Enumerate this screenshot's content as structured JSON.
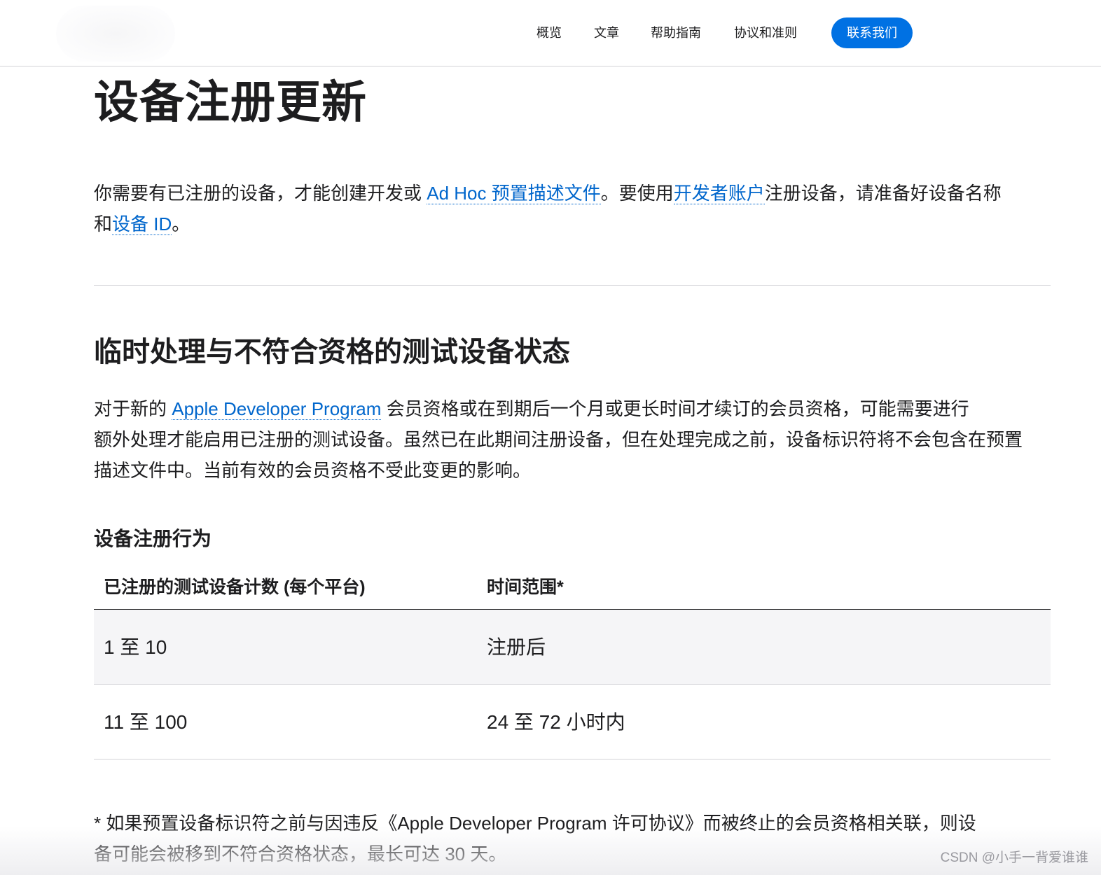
{
  "nav": {
    "items": [
      {
        "label": "概览"
      },
      {
        "label": "文章"
      },
      {
        "label": "帮助指南"
      },
      {
        "label": "协议和准则"
      }
    ],
    "cta_label": "联系我们"
  },
  "page": {
    "title": "设备注册更新",
    "intro": {
      "part1": "你需要有已注册的设备，才能创建开发或 ",
      "link1": "Ad Hoc 预置描述文件",
      "part2": "。要使用",
      "link2": "开发者账户",
      "part3": "注册设备，请准备好设备名称",
      "part4": "和",
      "link3": "设备 ID",
      "part5": "。"
    },
    "section": {
      "heading": "临时处理与不符合资格的测试设备状态",
      "para": {
        "part1": "对于新的 ",
        "link": "Apple Developer Program",
        "part2": " 会员资格或在到期后一个月或更长时间才续订的会员资格，可能需要进行",
        "line2": "额外处理才能启用已注册的测试设备。虽然已在此期间注册设备，但在处理完成之前，设备标识符将不会包含在预置",
        "line3": "描述文件中。当前有效的会员资格不受此变更的影响。"
      },
      "subheading": "设备注册行为",
      "table": {
        "headers": [
          "已注册的测试设备计数 (每个平台)",
          "时间范围*"
        ],
        "rows": [
          [
            "1 至 10",
            "注册后"
          ],
          [
            "11 至 100",
            "24 至 72 小时内"
          ]
        ]
      },
      "footnote": {
        "line1": "* 如果预置设备标识符之前与因违反《Apple Developer Program 许可协议》而被终止的会员资格相关联，则设",
        "line2": "备可能会被移到不符合资格状态，最长可达 30 天。"
      }
    }
  },
  "watermark": "CSDN @小手一背爱谁谁",
  "colors": {
    "link": "#0066cc",
    "cta_background": "#0071e3",
    "text": "#1d1d1f",
    "alt_row": "#f5f5f7",
    "divider": "#d2d2d7"
  }
}
